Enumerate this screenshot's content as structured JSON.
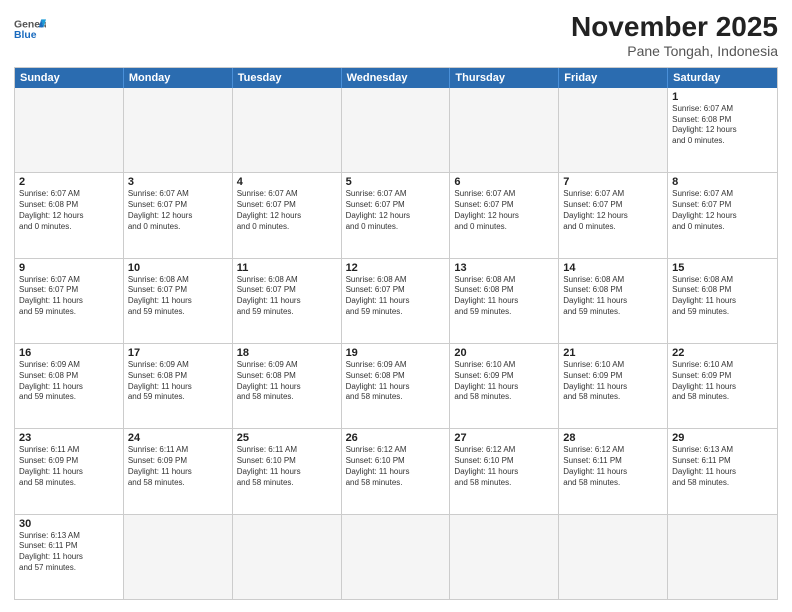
{
  "header": {
    "logo_general": "General",
    "logo_blue": "Blue",
    "title": "November 2025",
    "subtitle": "Pane Tongah, Indonesia"
  },
  "days": [
    "Sunday",
    "Monday",
    "Tuesday",
    "Wednesday",
    "Thursday",
    "Friday",
    "Saturday"
  ],
  "weeks": [
    [
      {
        "num": "",
        "info": "",
        "empty": true
      },
      {
        "num": "",
        "info": "",
        "empty": true
      },
      {
        "num": "",
        "info": "",
        "empty": true
      },
      {
        "num": "",
        "info": "",
        "empty": true
      },
      {
        "num": "",
        "info": "",
        "empty": true
      },
      {
        "num": "",
        "info": "",
        "empty": true
      },
      {
        "num": "1",
        "info": "Sunrise: 6:07 AM\nSunset: 6:08 PM\nDaylight: 12 hours\nand 0 minutes.",
        "empty": false
      }
    ],
    [
      {
        "num": "2",
        "info": "Sunrise: 6:07 AM\nSunset: 6:08 PM\nDaylight: 12 hours\nand 0 minutes."
      },
      {
        "num": "3",
        "info": "Sunrise: 6:07 AM\nSunset: 6:07 PM\nDaylight: 12 hours\nand 0 minutes."
      },
      {
        "num": "4",
        "info": "Sunrise: 6:07 AM\nSunset: 6:07 PM\nDaylight: 12 hours\nand 0 minutes."
      },
      {
        "num": "5",
        "info": "Sunrise: 6:07 AM\nSunset: 6:07 PM\nDaylight: 12 hours\nand 0 minutes."
      },
      {
        "num": "6",
        "info": "Sunrise: 6:07 AM\nSunset: 6:07 PM\nDaylight: 12 hours\nand 0 minutes."
      },
      {
        "num": "7",
        "info": "Sunrise: 6:07 AM\nSunset: 6:07 PM\nDaylight: 12 hours\nand 0 minutes."
      },
      {
        "num": "8",
        "info": "Sunrise: 6:07 AM\nSunset: 6:07 PM\nDaylight: 12 hours\nand 0 minutes."
      }
    ],
    [
      {
        "num": "9",
        "info": "Sunrise: 6:07 AM\nSunset: 6:07 PM\nDaylight: 11 hours\nand 59 minutes."
      },
      {
        "num": "10",
        "info": "Sunrise: 6:08 AM\nSunset: 6:07 PM\nDaylight: 11 hours\nand 59 minutes."
      },
      {
        "num": "11",
        "info": "Sunrise: 6:08 AM\nSunset: 6:07 PM\nDaylight: 11 hours\nand 59 minutes."
      },
      {
        "num": "12",
        "info": "Sunrise: 6:08 AM\nSunset: 6:07 PM\nDaylight: 11 hours\nand 59 minutes."
      },
      {
        "num": "13",
        "info": "Sunrise: 6:08 AM\nSunset: 6:08 PM\nDaylight: 11 hours\nand 59 minutes."
      },
      {
        "num": "14",
        "info": "Sunrise: 6:08 AM\nSunset: 6:08 PM\nDaylight: 11 hours\nand 59 minutes."
      },
      {
        "num": "15",
        "info": "Sunrise: 6:08 AM\nSunset: 6:08 PM\nDaylight: 11 hours\nand 59 minutes."
      }
    ],
    [
      {
        "num": "16",
        "info": "Sunrise: 6:09 AM\nSunset: 6:08 PM\nDaylight: 11 hours\nand 59 minutes."
      },
      {
        "num": "17",
        "info": "Sunrise: 6:09 AM\nSunset: 6:08 PM\nDaylight: 11 hours\nand 59 minutes."
      },
      {
        "num": "18",
        "info": "Sunrise: 6:09 AM\nSunset: 6:08 PM\nDaylight: 11 hours\nand 58 minutes."
      },
      {
        "num": "19",
        "info": "Sunrise: 6:09 AM\nSunset: 6:08 PM\nDaylight: 11 hours\nand 58 minutes."
      },
      {
        "num": "20",
        "info": "Sunrise: 6:10 AM\nSunset: 6:09 PM\nDaylight: 11 hours\nand 58 minutes."
      },
      {
        "num": "21",
        "info": "Sunrise: 6:10 AM\nSunset: 6:09 PM\nDaylight: 11 hours\nand 58 minutes."
      },
      {
        "num": "22",
        "info": "Sunrise: 6:10 AM\nSunset: 6:09 PM\nDaylight: 11 hours\nand 58 minutes."
      }
    ],
    [
      {
        "num": "23",
        "info": "Sunrise: 6:11 AM\nSunset: 6:09 PM\nDaylight: 11 hours\nand 58 minutes."
      },
      {
        "num": "24",
        "info": "Sunrise: 6:11 AM\nSunset: 6:09 PM\nDaylight: 11 hours\nand 58 minutes."
      },
      {
        "num": "25",
        "info": "Sunrise: 6:11 AM\nSunset: 6:10 PM\nDaylight: 11 hours\nand 58 minutes."
      },
      {
        "num": "26",
        "info": "Sunrise: 6:12 AM\nSunset: 6:10 PM\nDaylight: 11 hours\nand 58 minutes."
      },
      {
        "num": "27",
        "info": "Sunrise: 6:12 AM\nSunset: 6:10 PM\nDaylight: 11 hours\nand 58 minutes."
      },
      {
        "num": "28",
        "info": "Sunrise: 6:12 AM\nSunset: 6:11 PM\nDaylight: 11 hours\nand 58 minutes."
      },
      {
        "num": "29",
        "info": "Sunrise: 6:13 AM\nSunset: 6:11 PM\nDaylight: 11 hours\nand 58 minutes."
      }
    ],
    [
      {
        "num": "30",
        "info": "Sunrise: 6:13 AM\nSunset: 6:11 PM\nDaylight: 11 hours\nand 57 minutes."
      },
      {
        "num": "",
        "info": "",
        "empty": true
      },
      {
        "num": "",
        "info": "",
        "empty": true
      },
      {
        "num": "",
        "info": "",
        "empty": true
      },
      {
        "num": "",
        "info": "",
        "empty": true
      },
      {
        "num": "",
        "info": "",
        "empty": true
      },
      {
        "num": "",
        "info": "",
        "empty": true
      }
    ]
  ]
}
